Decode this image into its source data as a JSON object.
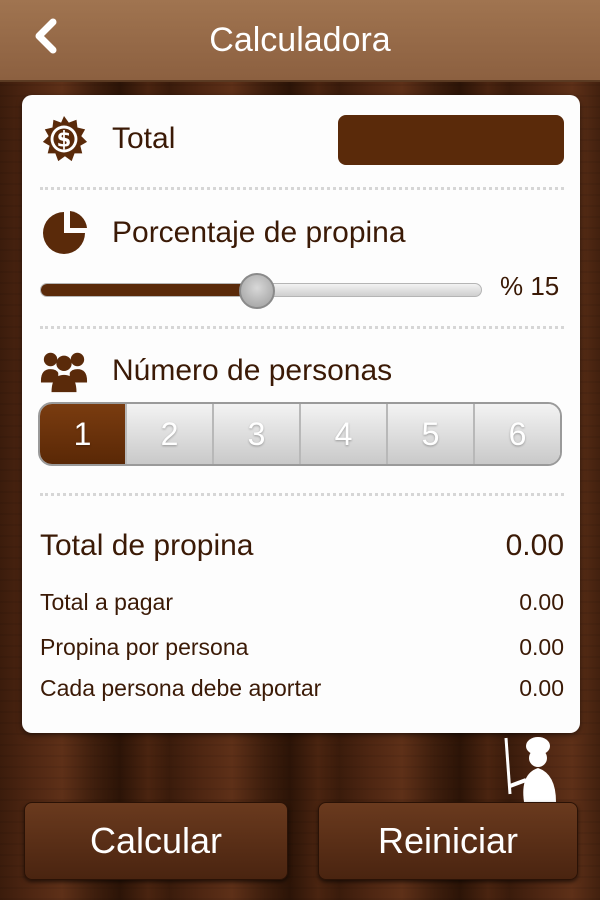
{
  "header": {
    "title": "Calculadora",
    "back_icon": "chevron-left-icon"
  },
  "total": {
    "label": "Total",
    "icon": "dollar-badge-icon",
    "value": ""
  },
  "tip": {
    "label": "Porcentaje de propina",
    "icon": "pie-chart-icon",
    "percent_text": "% 15",
    "slider_fraction": 0.49
  },
  "people": {
    "label": "Número de personas",
    "icon": "group-icon",
    "options": [
      "1",
      "2",
      "3",
      "4",
      "5",
      "6"
    ],
    "selected": "1"
  },
  "results": {
    "tip_total_label": "Total de propina",
    "tip_total_value": "0.00",
    "total_pay_label": "Total a pagar",
    "total_pay_value": "0.00",
    "tip_per_person_label": "Propina por persona",
    "tip_per_person_value": "0.00",
    "each_person_label": "Cada persona debe aportar",
    "each_person_value": "0.00"
  },
  "buttons": {
    "calculate": "Calcular",
    "reset": "Reiniciar"
  },
  "colors": {
    "accent": "#5a2a0a",
    "header": "#8c6040",
    "text": "#3b1a06"
  }
}
